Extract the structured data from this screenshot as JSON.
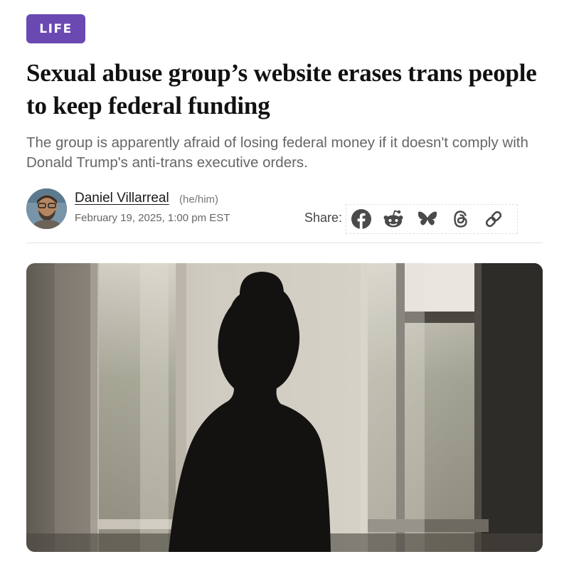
{
  "category": {
    "label": "LIFE",
    "color": "#6a49b3"
  },
  "article": {
    "headline": "Sexual abuse group’s website erases trans people to keep federal funding",
    "subheadline": "The group is apparently afraid of losing federal money if it doesn't comply with Donald Trump's anti-trans executive orders."
  },
  "author": {
    "name": "Daniel Villarreal",
    "pronouns": "(he/him)",
    "date": "February 19, 2025, 1:00 pm EST"
  },
  "share": {
    "label": "Share:",
    "icons": [
      "facebook-icon",
      "reddit-icon",
      "bluesky-icon",
      "threads-icon",
      "link-icon"
    ]
  }
}
